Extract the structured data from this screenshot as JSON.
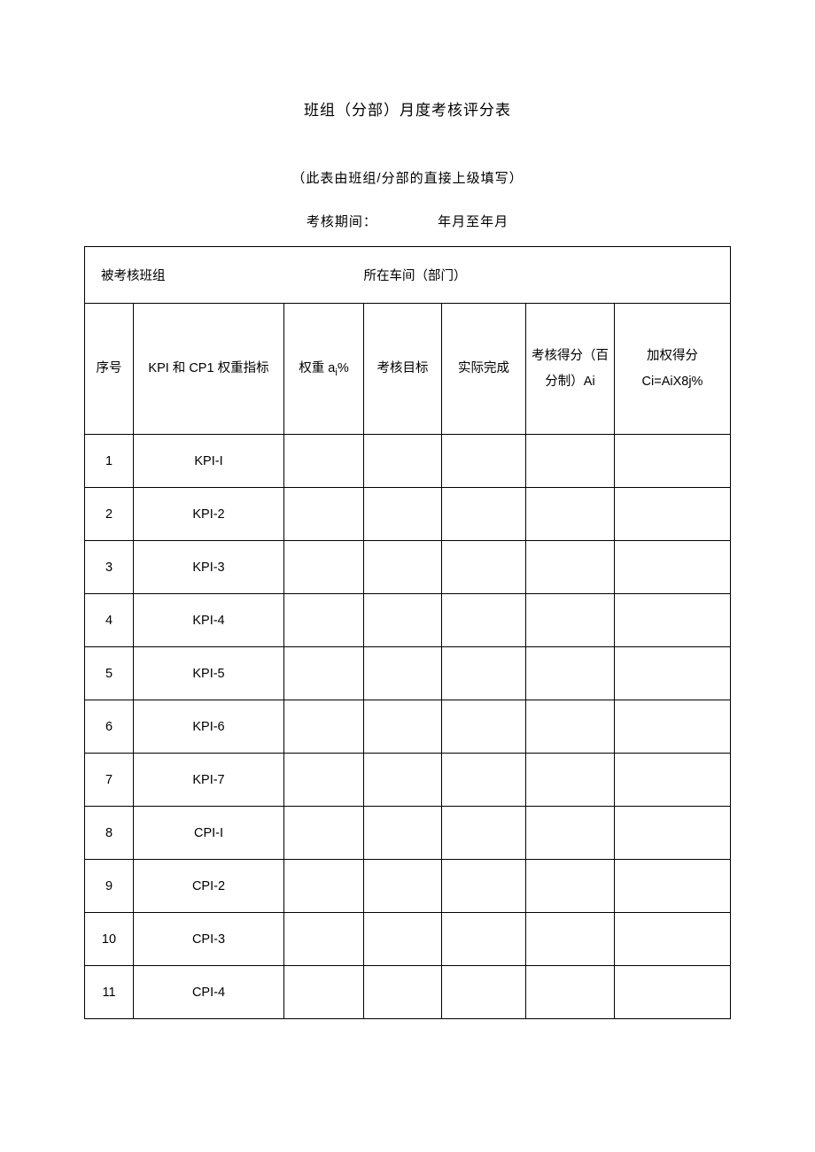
{
  "title": "班组（分部）月度考核评分表",
  "subtitle": "（此表由班组/分部的直接上级填写）",
  "period_label": "考核期间：",
  "period_range": "年月至年月",
  "info": {
    "team_label": "被考核班组",
    "team_value": "",
    "dept_label": "所在车间（部门）",
    "dept_value": ""
  },
  "headers": {
    "seq": "序号",
    "kpi_prefix": "KPI 和 CP1 权重指标",
    "weight_prefix": "权重 a",
    "weight_sub": "i",
    "weight_suffix": "%",
    "target": "考核目标",
    "actual": "实际完成",
    "score": "考核得分（百分制）Ai",
    "weighted_label": "加权得分",
    "weighted_formula": "Ci=AiX8j%"
  },
  "rows": [
    {
      "seq": "1",
      "name": "KPI-I",
      "weight": "",
      "target": "",
      "actual": "",
      "score": "",
      "weighted": ""
    },
    {
      "seq": "2",
      "name": "KPI-2",
      "weight": "",
      "target": "",
      "actual": "",
      "score": "",
      "weighted": ""
    },
    {
      "seq": "3",
      "name": "KPI-3",
      "weight": "",
      "target": "",
      "actual": "",
      "score": "",
      "weighted": ""
    },
    {
      "seq": "4",
      "name": "KPI-4",
      "weight": "",
      "target": "",
      "actual": "",
      "score": "",
      "weighted": ""
    },
    {
      "seq": "5",
      "name": "KPI-5",
      "weight": "",
      "target": "",
      "actual": "",
      "score": "",
      "weighted": ""
    },
    {
      "seq": "6",
      "name": "KPI-6",
      "weight": "",
      "target": "",
      "actual": "",
      "score": "",
      "weighted": ""
    },
    {
      "seq": "7",
      "name": "KPI-7",
      "weight": "",
      "target": "",
      "actual": "",
      "score": "",
      "weighted": ""
    },
    {
      "seq": "8",
      "name": "CPI-I",
      "weight": "",
      "target": "",
      "actual": "",
      "score": "",
      "weighted": ""
    },
    {
      "seq": "9",
      "name": "CPI-2",
      "weight": "",
      "target": "",
      "actual": "",
      "score": "",
      "weighted": ""
    },
    {
      "seq": "10",
      "name": "CPI-3",
      "weight": "",
      "target": "",
      "actual": "",
      "score": "",
      "weighted": ""
    },
    {
      "seq": "11",
      "name": "CPI-4",
      "weight": "",
      "target": "",
      "actual": "",
      "score": "",
      "weighted": ""
    }
  ]
}
